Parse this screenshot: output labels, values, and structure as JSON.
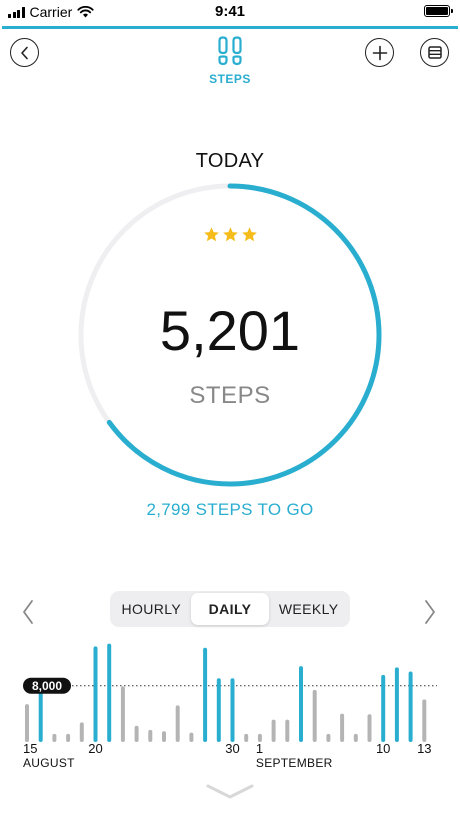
{
  "status_bar": {
    "carrier": "Carrier",
    "time": "9:41"
  },
  "header": {
    "title": "STEPS"
  },
  "summary": {
    "period_label": "TODAY",
    "rating_stars": 3,
    "step_count": "5,201",
    "unit_label": "STEPS",
    "remaining_text": "2,799 STEPS TO GO",
    "goal_progress": 0.65
  },
  "view_toggle": {
    "options": [
      "HOURLY",
      "DAILY",
      "WEEKLY"
    ],
    "selected": "DAILY"
  },
  "colors": {
    "accent": "#2aaed0",
    "track": "#efeff1",
    "bar_under_goal": "#b4b4b4",
    "star": "#f5bc1c"
  },
  "chart_data": {
    "type": "bar",
    "goal_label": "8,000",
    "goal": 8000,
    "x": [
      "15",
      "16",
      "17",
      "18",
      "19",
      "20",
      "21",
      "22",
      "23",
      "24",
      "25",
      "26",
      "27",
      "28",
      "29",
      "30",
      "31",
      "1",
      "2",
      "3",
      "4",
      "5",
      "6",
      "7",
      "8",
      "9",
      "10",
      "11",
      "12",
      "13"
    ],
    "tick_labels": [
      {
        "day": "15",
        "month": "AUGUST"
      },
      {
        "day": "20"
      },
      {
        "day": "30"
      },
      {
        "day": "1",
        "month": "SEPTEMBER"
      },
      {
        "day": "10"
      },
      {
        "day": "13"
      }
    ],
    "values": [
      5000,
      8000,
      600,
      600,
      2300,
      13500,
      13900,
      7600,
      1800,
      1200,
      1000,
      4800,
      800,
      13300,
      8800,
      8800,
      600,
      600,
      2700,
      2700,
      10600,
      7100,
      600,
      3600,
      600,
      3500,
      9300,
      10400,
      9800,
      5700
    ]
  }
}
